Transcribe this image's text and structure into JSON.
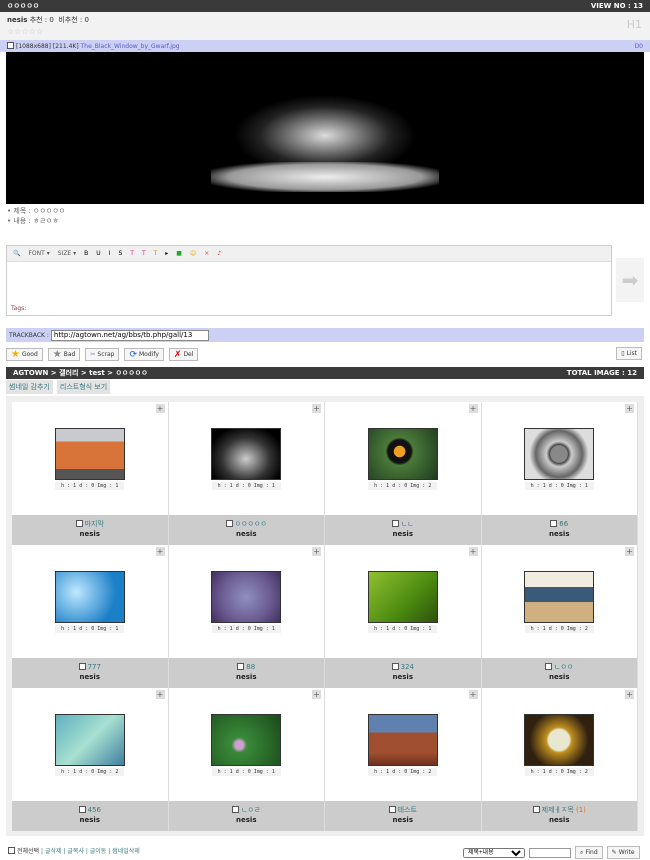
{
  "post": {
    "title": "ㅇㅇㅇㅇㅇ",
    "view_no": "VIEW NO : 13",
    "author": "nesis",
    "recommend": "추천 : 0",
    "not_recommend": "비추천 : 0",
    "stars": "☆☆☆☆☆",
    "heading": "H1",
    "file_dims": "[1088x688]",
    "file_size": "[211.4K]",
    "file_name": "The_Black_Window_by_Gwarf.jpg",
    "file_code": "D0",
    "subject_label": "제목 : ㅇㅇㅇㅇㅇ",
    "content_label": "내용 : ㅎㄹㅇㅎ"
  },
  "editor": {
    "tools": [
      "🔍",
      "FONT ▾",
      "SIZE ▾",
      "B",
      "U",
      "I",
      "S",
      "T",
      "T",
      "T",
      "▸",
      "■",
      "☺",
      "×",
      "♪"
    ],
    "tags_label": "Tags:",
    "send": "➡"
  },
  "trackback": {
    "label": "TRACKBACK :",
    "url": "http://agtown.net/ag/bbs/tb.php/gall/13"
  },
  "actions": {
    "good": "Good",
    "bad": "Bad",
    "scrap": "Scrap",
    "modify": "Modify",
    "del": "Del",
    "list": "List"
  },
  "gallery": {
    "breadcrumb": "AGTOWN > 갤러리 > test > ㅇㅇㅇㅇㅇ",
    "total": "TOTAL IMAGE : 12",
    "hide_thumb": "썸네일 감추기",
    "list_view": "리스트형식 보기",
    "items": [
      {
        "title": "마지막",
        "author": "nesis",
        "info": "h : 1 d : 0 Img : 1",
        "bg": "linear-gradient(#c9c9d0 0 25%,#d8743a 25% 80%,#555 80%)"
      },
      {
        "title": "ㅇㅇㅇㅇㅇ",
        "author": "nesis",
        "info": "h : 1 d : 0 Img : 1",
        "bg": "radial-gradient(ellipse at 50% 60%,#ccc,#333 50%,#000 80%)"
      },
      {
        "title": "ㄴㄴ",
        "author": "nesis",
        "info": "h : 1 d : 0 Img : 2",
        "bg": "radial-gradient(circle at 45% 45%,#f0a020 0 12%,#111 13% 25%,#4a7a3a 30%,#1e3a1e)"
      },
      {
        "title": "66",
        "author": "nesis",
        "info": "h : 1 d : 0 Img : 1",
        "bg": "radial-gradient(circle,#888 0 20%,#444 22%,#ccc 30%,#666 55%,#ddd 70%)"
      },
      {
        "title": "777",
        "author": "nesis",
        "info": "h : 1 d : 0 Img : 1",
        "bg": "radial-gradient(circle at 30% 40%,#bfe8ff,#1c80c8 70%)"
      },
      {
        "title": "88",
        "author": "nesis",
        "info": "h : 1 d : 0 Img : 1",
        "bg": "radial-gradient(circle at 50% 50%,#9090c0,#6a5a90 60%,#403060)"
      },
      {
        "title": "324",
        "author": "nesis",
        "info": "h : 1 d : 0 Img : 1",
        "bg": "linear-gradient(135deg,#90c030,#4a8a10 60%,#305010)"
      },
      {
        "title": "ㄴㅇㅇ",
        "author": "nesis",
        "info": "h : 1 d : 0 Img : 2",
        "bg": "linear-gradient(#f0ece0 0 30%,#3a5a7a 30% 60%,#d0b080 60%)"
      },
      {
        "title": "456",
        "author": "nesis",
        "info": "h : 1 d : 0 Img : 2",
        "bg": "linear-gradient(135deg,#60b0c0,#a8e0d0 50%,#4080a0)"
      },
      {
        "title": "ㄴㅇㄹ",
        "author": "nesis",
        "info": "h : 1 d : 0 Img : 1",
        "bg": "radial-gradient(circle at 40% 60%,#d0a0d0 0 8%,#3a8a3a 15%,#1a4a1a)"
      },
      {
        "title": "테스트",
        "author": "nesis",
        "info": "h : 1 d : 0 Img : 2",
        "bg": "linear-gradient(#6080b0 0 35%,#a05030 35% 75%,#703020)"
      },
      {
        "title": "제제ㅔㅈ목",
        "author": "nesis",
        "info": "h : 1 d : 0 Img : 2",
        "comments": "(1)",
        "bg": "radial-gradient(circle,#e8e8d0 0 25%,#c09020 30%,#302010 70%)"
      }
    ]
  },
  "footer": {
    "select_all": "전체선택",
    "links": [
      "글삭제",
      "글복사",
      "글이동",
      "썸네일삭제"
    ],
    "search_option": "제목+내용",
    "find": "Find",
    "write": "Write"
  }
}
